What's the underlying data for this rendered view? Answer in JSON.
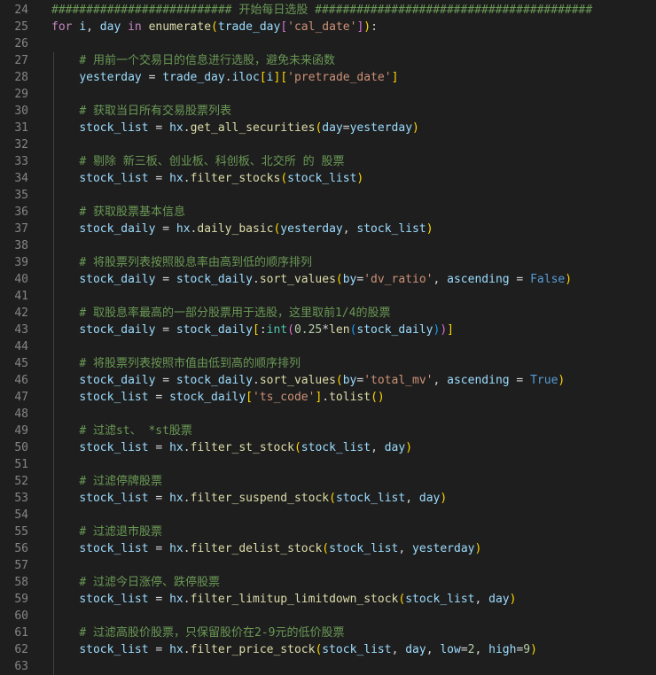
{
  "editor": {
    "lines": [
      {
        "n": "24",
        "tokens": [
          [
            "cm",
            "########################## 开始每日选股 ########################################"
          ]
        ]
      },
      {
        "n": "25",
        "tokens": [
          [
            "kw",
            "for"
          ],
          [
            "plain",
            " "
          ],
          [
            "var",
            "i"
          ],
          [
            "plain",
            ", "
          ],
          [
            "var",
            "day"
          ],
          [
            "plain",
            " "
          ],
          [
            "kw",
            "in"
          ],
          [
            "plain",
            " "
          ],
          [
            "fn",
            "enumerate"
          ],
          [
            "b1",
            "("
          ],
          [
            "var",
            "trade_day"
          ],
          [
            "b2",
            "["
          ],
          [
            "str",
            "'cal_date'"
          ],
          [
            "b2",
            "]"
          ],
          [
            "b1",
            ")"
          ],
          [
            "plain",
            ":"
          ]
        ]
      },
      {
        "n": "26",
        "tokens": []
      },
      {
        "n": "27",
        "tokens": [
          [
            "plain",
            "    "
          ],
          [
            "cm",
            "# 用前一个交易日的信息进行选股，避免未来函数"
          ]
        ]
      },
      {
        "n": "28",
        "tokens": [
          [
            "plain",
            "    "
          ],
          [
            "var",
            "yesterday"
          ],
          [
            "plain",
            " = "
          ],
          [
            "var",
            "trade_day"
          ],
          [
            "plain",
            "."
          ],
          [
            "var",
            "iloc"
          ],
          [
            "b1",
            "["
          ],
          [
            "var",
            "i"
          ],
          [
            "b1",
            "]"
          ],
          [
            "b1",
            "["
          ],
          [
            "str",
            "'pretrade_date'"
          ],
          [
            "b1",
            "]"
          ]
        ]
      },
      {
        "n": "29",
        "tokens": []
      },
      {
        "n": "30",
        "tokens": [
          [
            "plain",
            "    "
          ],
          [
            "cm",
            "# 获取当日所有交易股票列表"
          ]
        ]
      },
      {
        "n": "31",
        "tokens": [
          [
            "plain",
            "    "
          ],
          [
            "var",
            "stock_list"
          ],
          [
            "plain",
            " = "
          ],
          [
            "var",
            "hx"
          ],
          [
            "plain",
            "."
          ],
          [
            "fn",
            "get_all_securities"
          ],
          [
            "b1",
            "("
          ],
          [
            "var",
            "day"
          ],
          [
            "plain",
            "="
          ],
          [
            "var",
            "yesterday"
          ],
          [
            "b1",
            ")"
          ]
        ]
      },
      {
        "n": "32",
        "tokens": []
      },
      {
        "n": "33",
        "tokens": [
          [
            "plain",
            "    "
          ],
          [
            "cm",
            "# 剔除 新三板、创业板、科创板、北交所 的 股票"
          ]
        ]
      },
      {
        "n": "34",
        "tokens": [
          [
            "plain",
            "    "
          ],
          [
            "var",
            "stock_list"
          ],
          [
            "plain",
            " = "
          ],
          [
            "var",
            "hx"
          ],
          [
            "plain",
            "."
          ],
          [
            "fn",
            "filter_stocks"
          ],
          [
            "b1",
            "("
          ],
          [
            "var",
            "stock_list"
          ],
          [
            "b1",
            ")"
          ]
        ]
      },
      {
        "n": "35",
        "tokens": []
      },
      {
        "n": "36",
        "tokens": [
          [
            "plain",
            "    "
          ],
          [
            "cm",
            "# 获取股票基本信息"
          ]
        ]
      },
      {
        "n": "37",
        "tokens": [
          [
            "plain",
            "    "
          ],
          [
            "var",
            "stock_daily"
          ],
          [
            "plain",
            " = "
          ],
          [
            "var",
            "hx"
          ],
          [
            "plain",
            "."
          ],
          [
            "fn",
            "daily_basic"
          ],
          [
            "b1",
            "("
          ],
          [
            "var",
            "yesterday"
          ],
          [
            "plain",
            ", "
          ],
          [
            "var",
            "stock_list"
          ],
          [
            "b1",
            ")"
          ]
        ]
      },
      {
        "n": "38",
        "tokens": []
      },
      {
        "n": "39",
        "tokens": [
          [
            "plain",
            "    "
          ],
          [
            "cm",
            "# 将股票列表按照股息率由高到低的顺序排列"
          ]
        ]
      },
      {
        "n": "40",
        "tokens": [
          [
            "plain",
            "    "
          ],
          [
            "var",
            "stock_daily"
          ],
          [
            "plain",
            " = "
          ],
          [
            "var",
            "stock_daily"
          ],
          [
            "plain",
            "."
          ],
          [
            "fn",
            "sort_values"
          ],
          [
            "b1",
            "("
          ],
          [
            "var",
            "by"
          ],
          [
            "plain",
            "="
          ],
          [
            "str",
            "'dv_ratio'"
          ],
          [
            "plain",
            ", "
          ],
          [
            "var",
            "ascending"
          ],
          [
            "plain",
            " = "
          ],
          [
            "const",
            "False"
          ],
          [
            "b1",
            ")"
          ]
        ]
      },
      {
        "n": "41",
        "tokens": []
      },
      {
        "n": "42",
        "tokens": [
          [
            "plain",
            "    "
          ],
          [
            "cm",
            "# 取股息率最高的一部分股票用于选股，这里取前1/4的股票"
          ]
        ]
      },
      {
        "n": "43",
        "tokens": [
          [
            "plain",
            "    "
          ],
          [
            "var",
            "stock_daily"
          ],
          [
            "plain",
            " = "
          ],
          [
            "var",
            "stock_daily"
          ],
          [
            "b1",
            "["
          ],
          [
            "plain",
            ":"
          ],
          [
            "cls",
            "int"
          ],
          [
            "b2",
            "("
          ],
          [
            "num",
            "0.25"
          ],
          [
            "plain",
            "*"
          ],
          [
            "fn",
            "len"
          ],
          [
            "b3",
            "("
          ],
          [
            "var",
            "stock_daily"
          ],
          [
            "b3",
            ")"
          ],
          [
            "b2",
            ")"
          ],
          [
            "b1",
            "]"
          ]
        ]
      },
      {
        "n": "44",
        "tokens": []
      },
      {
        "n": "45",
        "tokens": [
          [
            "plain",
            "    "
          ],
          [
            "cm",
            "# 将股票列表按照市值由低到高的顺序排列"
          ]
        ]
      },
      {
        "n": "46",
        "tokens": [
          [
            "plain",
            "    "
          ],
          [
            "var",
            "stock_daily"
          ],
          [
            "plain",
            " = "
          ],
          [
            "var",
            "stock_daily"
          ],
          [
            "plain",
            "."
          ],
          [
            "fn",
            "sort_values"
          ],
          [
            "b1",
            "("
          ],
          [
            "var",
            "by"
          ],
          [
            "plain",
            "="
          ],
          [
            "str",
            "'total_mv'"
          ],
          [
            "plain",
            ", "
          ],
          [
            "var",
            "ascending"
          ],
          [
            "plain",
            " = "
          ],
          [
            "const",
            "True"
          ],
          [
            "b1",
            ")"
          ]
        ]
      },
      {
        "n": "47",
        "tokens": [
          [
            "plain",
            "    "
          ],
          [
            "var",
            "stock_list"
          ],
          [
            "plain",
            " = "
          ],
          [
            "var",
            "stock_daily"
          ],
          [
            "b1",
            "["
          ],
          [
            "str",
            "'ts_code'"
          ],
          [
            "b1",
            "]"
          ],
          [
            "plain",
            "."
          ],
          [
            "fn",
            "tolist"
          ],
          [
            "b1",
            "("
          ],
          [
            "b1",
            ")"
          ]
        ]
      },
      {
        "n": "48",
        "tokens": []
      },
      {
        "n": "49",
        "tokens": [
          [
            "plain",
            "    "
          ],
          [
            "cm",
            "# 过滤st、 *st股票"
          ]
        ]
      },
      {
        "n": "50",
        "tokens": [
          [
            "plain",
            "    "
          ],
          [
            "var",
            "stock_list"
          ],
          [
            "plain",
            " = "
          ],
          [
            "var",
            "hx"
          ],
          [
            "plain",
            "."
          ],
          [
            "fn",
            "filter_st_stock"
          ],
          [
            "b1",
            "("
          ],
          [
            "var",
            "stock_list"
          ],
          [
            "plain",
            ", "
          ],
          [
            "var",
            "day"
          ],
          [
            "b1",
            ")"
          ]
        ]
      },
      {
        "n": "51",
        "tokens": []
      },
      {
        "n": "52",
        "tokens": [
          [
            "plain",
            "    "
          ],
          [
            "cm",
            "# 过滤停牌股票"
          ]
        ]
      },
      {
        "n": "53",
        "tokens": [
          [
            "plain",
            "    "
          ],
          [
            "var",
            "stock_list"
          ],
          [
            "plain",
            " = "
          ],
          [
            "var",
            "hx"
          ],
          [
            "plain",
            "."
          ],
          [
            "fn",
            "filter_suspend_stock"
          ],
          [
            "b1",
            "("
          ],
          [
            "var",
            "stock_list"
          ],
          [
            "plain",
            ", "
          ],
          [
            "var",
            "day"
          ],
          [
            "b1",
            ")"
          ]
        ]
      },
      {
        "n": "54",
        "tokens": []
      },
      {
        "n": "55",
        "tokens": [
          [
            "plain",
            "    "
          ],
          [
            "cm",
            "# 过滤退市股票"
          ]
        ]
      },
      {
        "n": "56",
        "tokens": [
          [
            "plain",
            "    "
          ],
          [
            "var",
            "stock_list"
          ],
          [
            "plain",
            " = "
          ],
          [
            "var",
            "hx"
          ],
          [
            "plain",
            "."
          ],
          [
            "fn",
            "filter_delist_stock"
          ],
          [
            "b1",
            "("
          ],
          [
            "var",
            "stock_list"
          ],
          [
            "plain",
            ", "
          ],
          [
            "var",
            "yesterday"
          ],
          [
            "b1",
            ")"
          ]
        ]
      },
      {
        "n": "57",
        "tokens": []
      },
      {
        "n": "58",
        "tokens": [
          [
            "plain",
            "    "
          ],
          [
            "cm",
            "# 过滤今日涨停、跌停股票"
          ]
        ]
      },
      {
        "n": "59",
        "tokens": [
          [
            "plain",
            "    "
          ],
          [
            "var",
            "stock_list"
          ],
          [
            "plain",
            " = "
          ],
          [
            "var",
            "hx"
          ],
          [
            "plain",
            "."
          ],
          [
            "fn",
            "filter_limitup_limitdown_stock"
          ],
          [
            "b1",
            "("
          ],
          [
            "var",
            "stock_list"
          ],
          [
            "plain",
            ", "
          ],
          [
            "var",
            "day"
          ],
          [
            "b1",
            ")"
          ]
        ]
      },
      {
        "n": "60",
        "tokens": []
      },
      {
        "n": "61",
        "tokens": [
          [
            "plain",
            "    "
          ],
          [
            "cm",
            "# 过滤高股价股票，只保留股价在2-9元的低价股票"
          ]
        ]
      },
      {
        "n": "62",
        "tokens": [
          [
            "plain",
            "    "
          ],
          [
            "var",
            "stock_list"
          ],
          [
            "plain",
            " = "
          ],
          [
            "var",
            "hx"
          ],
          [
            "plain",
            "."
          ],
          [
            "fn",
            "filter_price_stock"
          ],
          [
            "b1",
            "("
          ],
          [
            "var",
            "stock_list"
          ],
          [
            "plain",
            ", "
          ],
          [
            "var",
            "day"
          ],
          [
            "plain",
            ", "
          ],
          [
            "var",
            "low"
          ],
          [
            "plain",
            "="
          ],
          [
            "num",
            "2"
          ],
          [
            "plain",
            ", "
          ],
          [
            "var",
            "high"
          ],
          [
            "plain",
            "="
          ],
          [
            "num",
            "9"
          ],
          [
            "b1",
            ")"
          ]
        ]
      },
      {
        "n": "63",
        "tokens": []
      }
    ]
  }
}
